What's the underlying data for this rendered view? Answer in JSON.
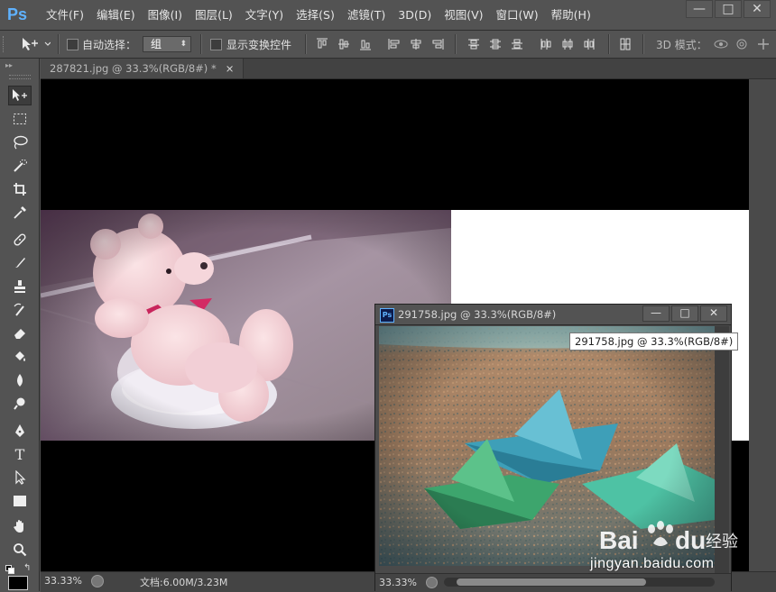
{
  "app": {
    "logo_text": "Ps"
  },
  "menu": [
    "文件(F)",
    "编辑(E)",
    "图像(I)",
    "图层(L)",
    "文字(Y)",
    "选择(S)",
    "滤镜(T)",
    "3D(D)",
    "视图(V)",
    "窗口(W)",
    "帮助(H)"
  ],
  "window_controls": {
    "minimize": "—",
    "maximize": "□",
    "close": "✕"
  },
  "options": {
    "auto_select_label": "自动选择：",
    "auto_select_value": "组",
    "show_transform_label": "显示变换控件",
    "mode_3d_label": "3D 模式："
  },
  "tools": [
    "move-tool",
    "marquee-tool",
    "lasso-tool",
    "quick-select-tool",
    "crop-tool",
    "eyedropper-tool",
    "healing-brush-tool",
    "brush-tool",
    "clone-stamp-tool",
    "history-brush-tool",
    "eraser-tool",
    "paint-bucket-tool",
    "blur-tool",
    "dodge-tool",
    "pen-tool",
    "type-tool",
    "path-select-tool",
    "shape-tool",
    "hand-tool",
    "zoom-tool"
  ],
  "main_doc": {
    "tab_title": "287821.jpg @ 33.3%(RGB/8#) *",
    "tab_close": "×",
    "status_zoom": "33.33%",
    "status_doc": "文档:6.00M/3.23M"
  },
  "float_doc": {
    "title": "291758.jpg @ 33.3%(RGB/8#)",
    "status_zoom": "33.33%",
    "tooltip": "291758.jpg @ 33.3%(RGB/8#)",
    "controls": {
      "minimize": "—",
      "maximize": "□",
      "close": "✕"
    }
  },
  "watermark": {
    "brand": "Baidu经验",
    "url": "jingyan.baidu.com"
  },
  "colors": {
    "panel": "#535353",
    "canvas": "#000000",
    "accent": "#5fb2ff"
  }
}
